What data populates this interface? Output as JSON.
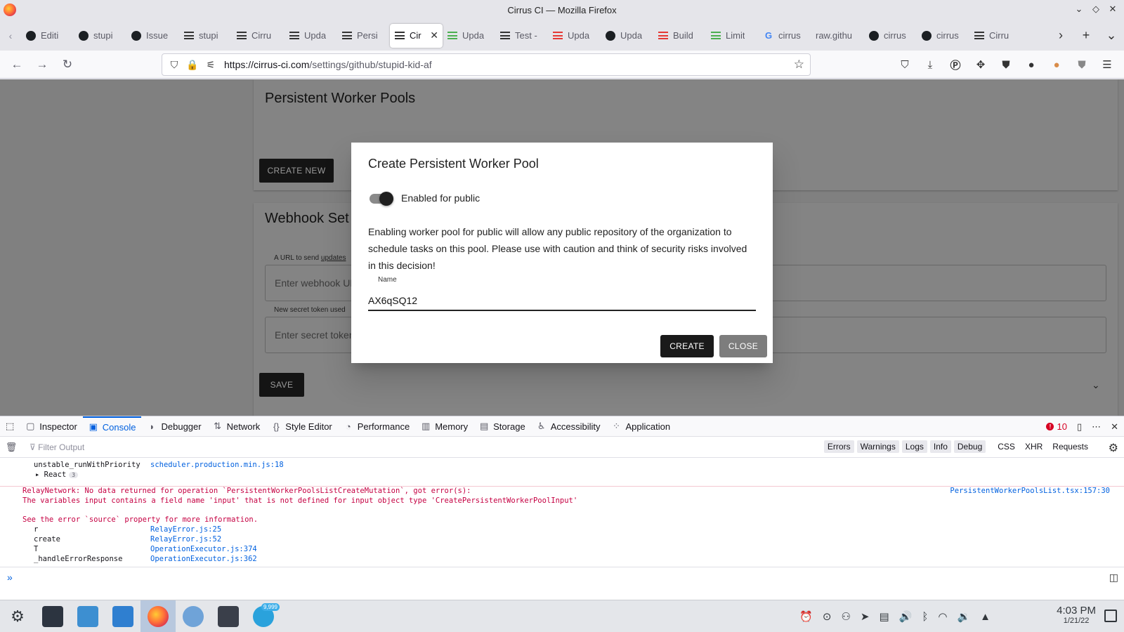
{
  "window": {
    "title": "Cirrus CI — Mozilla Firefox",
    "controls": [
      "⌄",
      "◇",
      "✕"
    ]
  },
  "tabs": [
    {
      "icon": "github-icon",
      "label": "Editi"
    },
    {
      "icon": "github-icon",
      "label": "stupi"
    },
    {
      "icon": "github-icon",
      "label": "Issue"
    },
    {
      "icon": "cirrus-icon",
      "label": "stupi"
    },
    {
      "icon": "cirrus-icon",
      "label": "Cirru"
    },
    {
      "icon": "cirrus-icon",
      "label": "Upda"
    },
    {
      "icon": "cirrus-icon",
      "label": "Persi"
    },
    {
      "icon": "cirrus-icon",
      "label": "Cir",
      "active": true
    },
    {
      "icon": "cirrus-green-icon",
      "label": "Upda"
    },
    {
      "icon": "cirrus-icon",
      "label": "Test -"
    },
    {
      "icon": "cirrus-red-icon",
      "label": "Upda"
    },
    {
      "icon": "github-icon",
      "label": "Upda"
    },
    {
      "icon": "cirrus-red-icon",
      "label": "Build"
    },
    {
      "icon": "cirrus-green-icon",
      "label": "Limit"
    },
    {
      "icon": "google-icon",
      "label": "cirrus"
    },
    {
      "icon": "none",
      "label": "raw.githu"
    },
    {
      "icon": "github-icon",
      "label": "cirrus"
    },
    {
      "icon": "github-icon",
      "label": "cirrus"
    },
    {
      "icon": "cirrus-icon",
      "label": "Cirru"
    }
  ],
  "navbar": {
    "url_host": "https://cirrus-ci.com",
    "url_path": "/settings/github/stupid-kid-af"
  },
  "page": {
    "worker_pools_title": "Persistent Worker Pools",
    "create_new_label": "CREATE NEW",
    "webhook_title": "Webhook Set",
    "webhook_hint_prefix": "A URL to send ",
    "webhook_hint_link": "updates",
    "webhook_placeholder": "Enter webhook UR",
    "secret_hint": "New secret token used",
    "secret_placeholder": "Enter secret token",
    "save_label": "SAVE"
  },
  "dialog": {
    "title": "Create Persistent Worker Pool",
    "toggle_label": "Enabled for public",
    "toggle_on": true,
    "description": "Enabling worker pool for public will allow any public repository of the organization to schedule tasks on this pool. Please use with caution and think of security risks involved in this decision!",
    "name_label": "Name",
    "name_value": "AX6qSQ12",
    "create_label": "CREATE",
    "close_label": "CLOSE"
  },
  "devtools": {
    "tabs": [
      {
        "icon": "inspector-icon",
        "label": "Inspector"
      },
      {
        "icon": "console-icon",
        "label": "Console",
        "active": true
      },
      {
        "icon": "debugger-icon",
        "label": "Debugger"
      },
      {
        "icon": "network-icon",
        "label": "Network"
      },
      {
        "icon": "style-editor-icon",
        "label": "Style Editor"
      },
      {
        "icon": "performance-icon",
        "label": "Performance"
      },
      {
        "icon": "memory-icon",
        "label": "Memory"
      },
      {
        "icon": "storage-icon",
        "label": "Storage"
      },
      {
        "icon": "accessibility-icon",
        "label": "Accessibility"
      },
      {
        "icon": "application-icon",
        "label": "Application"
      }
    ],
    "error_count": "10",
    "filter_placeholder": "Filter Output",
    "filters": [
      "Errors",
      "Warnings",
      "Logs",
      "Info",
      "Debug"
    ],
    "extra_filters": [
      "CSS",
      "XHR",
      "Requests"
    ],
    "console_lines": {
      "stack_top_fn": "unstable_runWithPriority",
      "stack_top_src": "scheduler.production.min.js:18",
      "react_label": "React",
      "react_count": "3",
      "error_line1": "RelayNetwork: No data returned for operation `PersistentWorkerPoolsListCreateMutation`, got error(s):",
      "error_line2": "The variables input contains a field name 'input' that is not defined for input object type 'CreatePersistentWorkerPoolInput'",
      "error_line3": "See the error `source` property for more information.",
      "error_source": "PersistentWorkerPoolsList.tsx:157:30",
      "stack": [
        {
          "fn": "r",
          "src": "RelayError.js:25"
        },
        {
          "fn": "create",
          "src": "RelayError.js:52"
        },
        {
          "fn": "T",
          "src": "OperationExecutor.js:374"
        },
        {
          "fn": "_handleErrorResponse",
          "src": "OperationExecutor.js:362"
        }
      ]
    }
  },
  "taskbar": {
    "badge": "9,999",
    "time": "4:03 PM",
    "date": "1/21/22"
  }
}
